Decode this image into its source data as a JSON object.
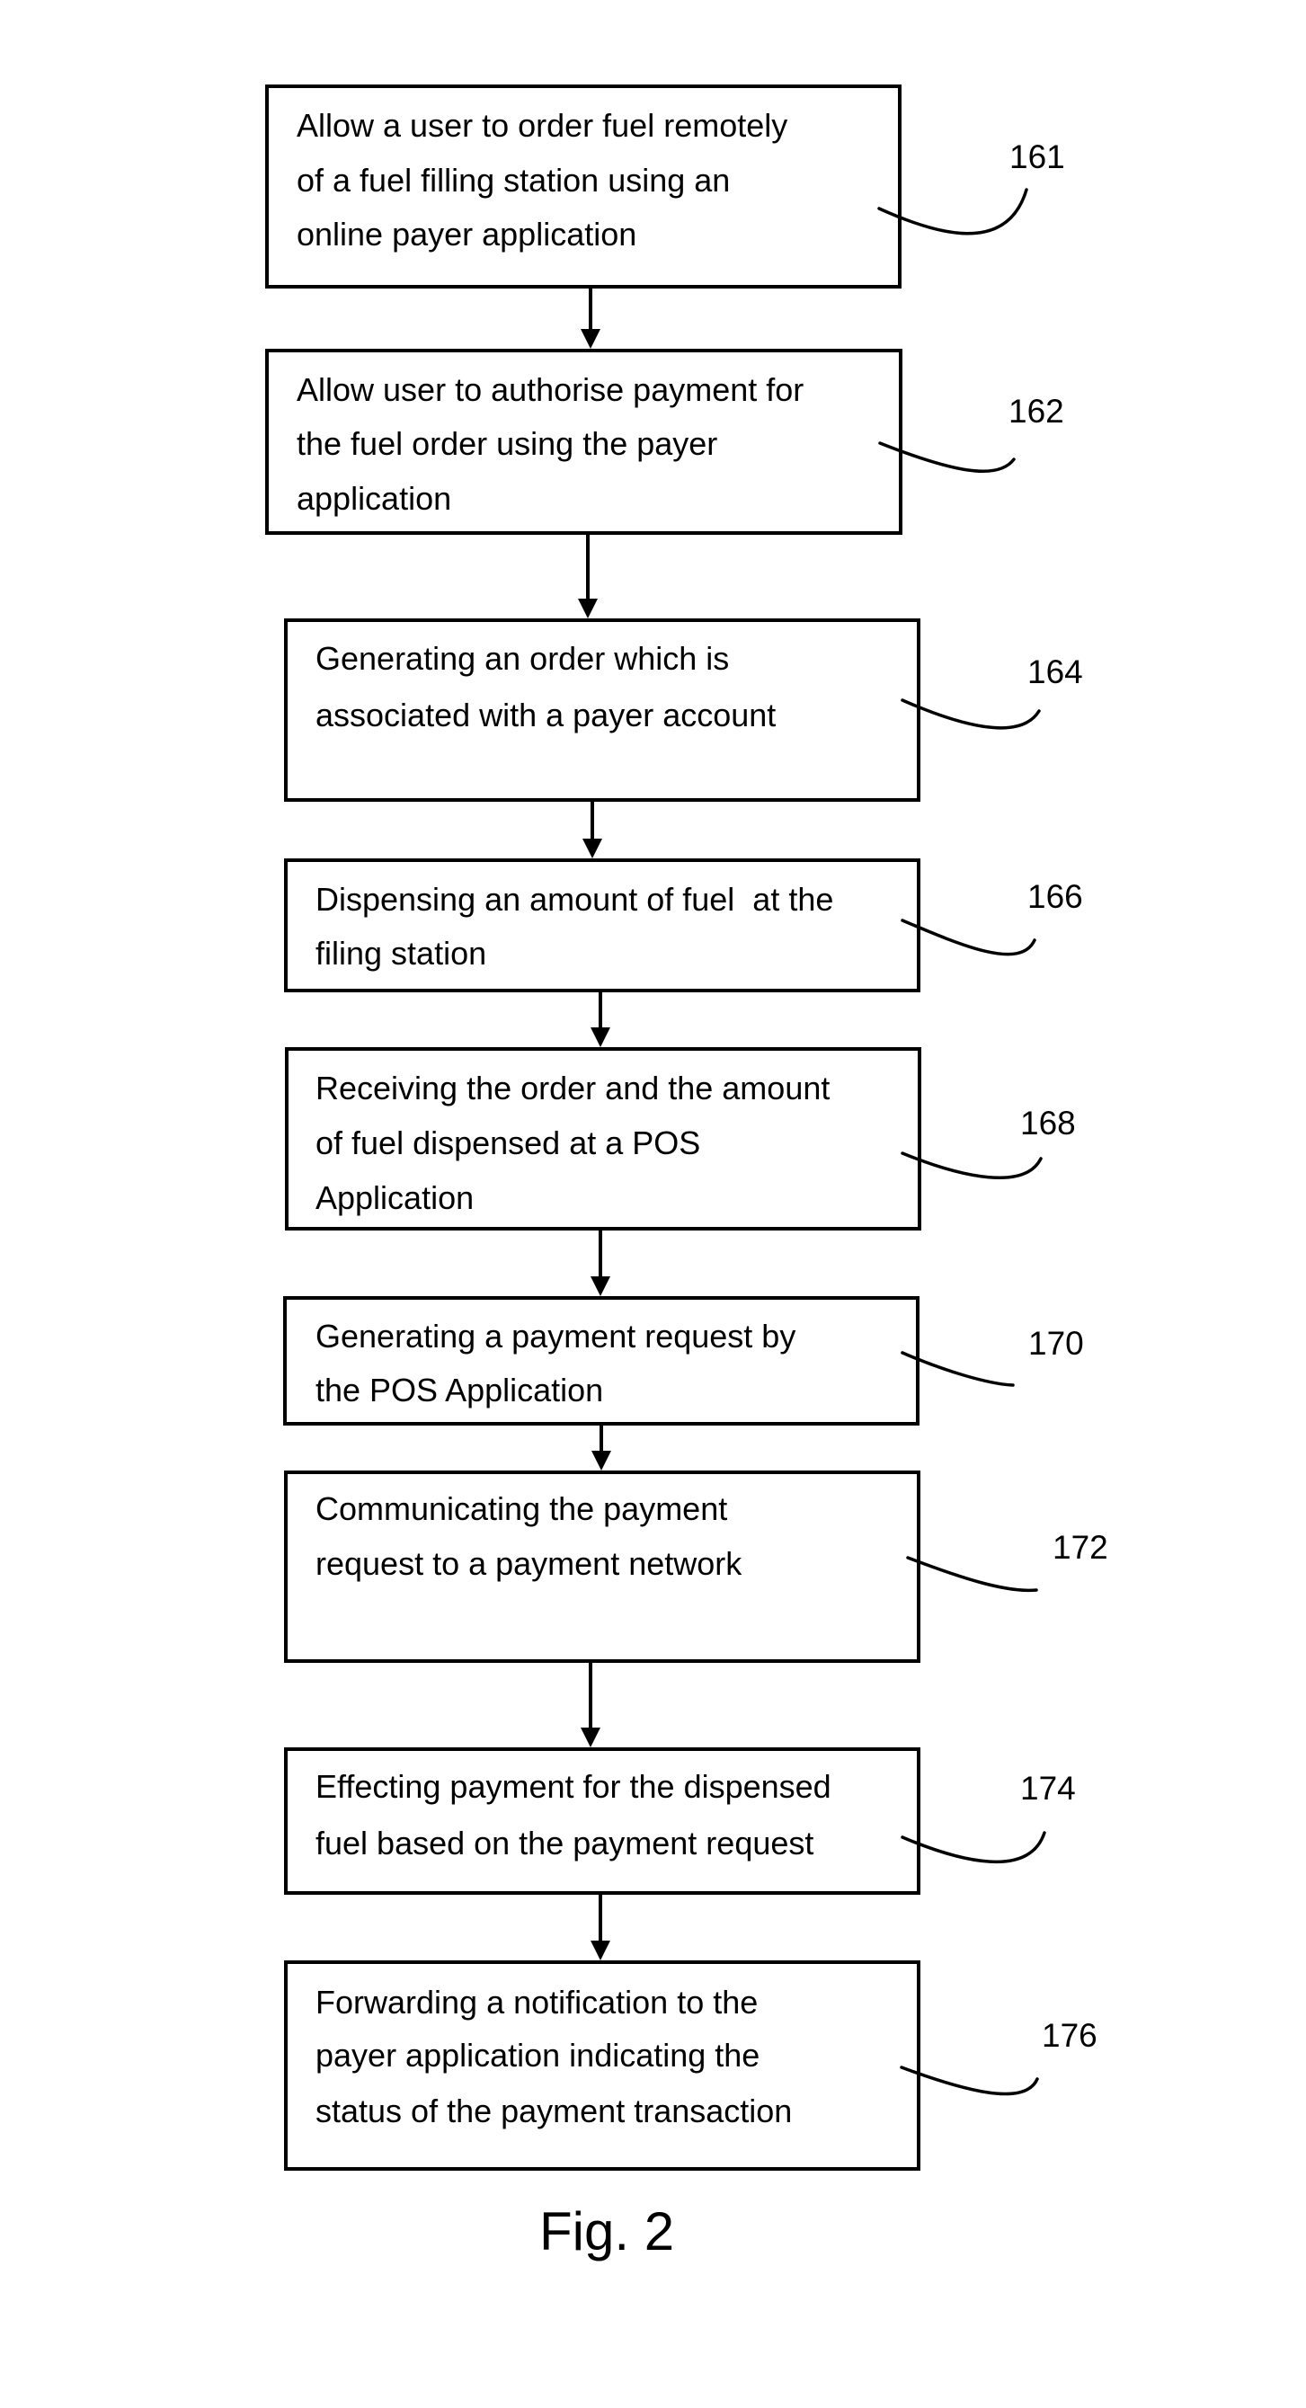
{
  "figure": {
    "caption": "Fig. 2",
    "type": "flowchart",
    "direction": "top-to-bottom"
  },
  "steps": [
    {
      "ref": "161",
      "lines": [
        "Allow a user to order fuel remotely",
        "of a fuel filling station using an",
        "online payer application"
      ]
    },
    {
      "ref": "162",
      "lines": [
        "Allow user to authorise payment for",
        "the fuel order using the payer",
        "application"
      ]
    },
    {
      "ref": "164",
      "lines": [
        "Generating an order which is",
        "associated with a payer account"
      ]
    },
    {
      "ref": "166",
      "lines": [
        "Dispensing an amount of fuel  at the",
        "filing station"
      ]
    },
    {
      "ref": "168",
      "lines": [
        "Receiving the order and the amount",
        "of fuel dispensed at a POS",
        "Application"
      ]
    },
    {
      "ref": "170",
      "lines": [
        "Generating a payment request by",
        "the POS Application"
      ]
    },
    {
      "ref": "172",
      "lines": [
        "Communicating the payment",
        "request to a payment network"
      ]
    },
    {
      "ref": "174",
      "lines": [
        "Effecting payment for the dispensed",
        "fuel based on the payment request"
      ]
    },
    {
      "ref": "176",
      "lines": [
        "Forwarding a notification to the",
        "payer application indicating the",
        "status of the payment transaction"
      ]
    }
  ],
  "connections": [
    {
      "from": "161",
      "to": "162"
    },
    {
      "from": "162",
      "to": "164"
    },
    {
      "from": "164",
      "to": "166"
    },
    {
      "from": "166",
      "to": "168"
    },
    {
      "from": "168",
      "to": "170"
    },
    {
      "from": "170",
      "to": "172"
    },
    {
      "from": "172",
      "to": "174"
    },
    {
      "from": "174",
      "to": "176"
    }
  ]
}
